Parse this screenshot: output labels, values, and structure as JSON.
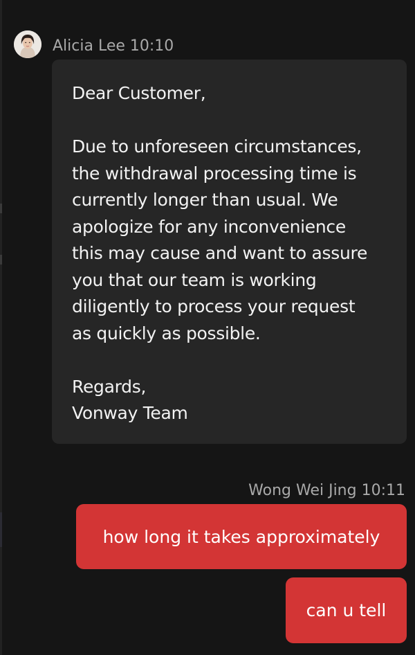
{
  "incoming": {
    "sender": "Alicia Lee",
    "time": "10:10",
    "header": "Alicia Lee 10:10",
    "greeting": "Dear Customer,",
    "body_lines": [
      "Due to unforeseen circumstances,",
      "the withdrawal processing time is",
      "currently longer than usual. We",
      "apologize for any inconvenience",
      "this may cause and want to assure",
      "you that our team is working",
      "diligently to process your request",
      "as quickly as possible."
    ],
    "sign_off": "Regards,",
    "signature": "Vonway Team"
  },
  "outgoing": {
    "sender": "Wong Wei Jing",
    "time": "10:11",
    "header": "Wong Wei Jing 10:11",
    "messages": [
      "how long it takes approximately",
      "can u tell"
    ]
  },
  "colors": {
    "background": "#151515",
    "incoming_bubble": "#262626",
    "outgoing_bubble": "#d33535",
    "meta_text": "#a9a9a9"
  }
}
